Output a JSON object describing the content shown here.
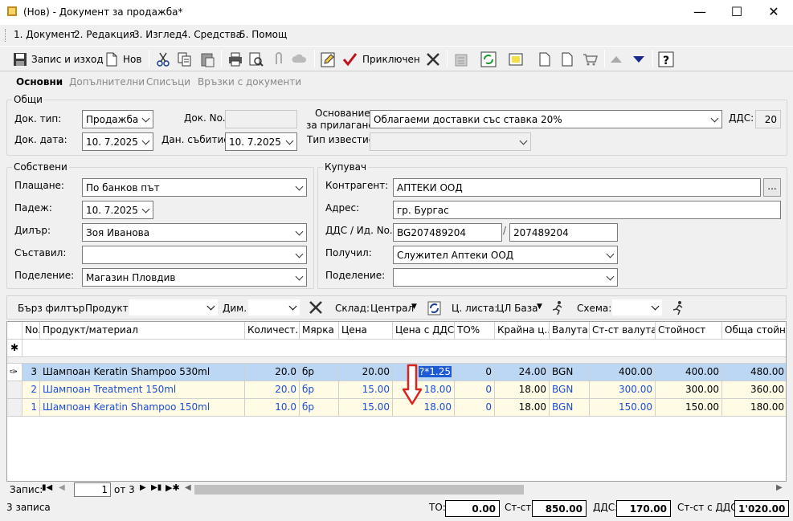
{
  "window": {
    "title": "(Нов) - Документ за продажба*"
  },
  "menu": [
    "1. Документ",
    "2. Редакция",
    "3. Изглед",
    "4. Средства",
    "5. Помощ"
  ],
  "toolbar": {
    "save_exit": "Запис и изход",
    "new": "Нов",
    "finished": "Приключен"
  },
  "tabs": [
    "Основни",
    "Допълнителни",
    "Списъци",
    "Връзки с документи"
  ],
  "general": {
    "group": "Общи",
    "doc_type_label": "Док. тип:",
    "doc_type": "Продажба",
    "doc_no_label": "Док. No.",
    "doc_no": "",
    "basis_label1": "Основание",
    "basis_label2": "за прилагане:",
    "basis": "Облагаеми доставки със ставка 20%",
    "vat_label": "ДДС:",
    "vat": "20",
    "doc_date_label": "Док. дата:",
    "doc_date": "10.  7.2025",
    "tax_date_label": "Дан. събитие:",
    "tax_date": "10.  7.2025",
    "notice_label": "Тип известие:",
    "notice": ""
  },
  "own": {
    "group": "Собствени",
    "payment_label": "Плащане:",
    "payment": "По банков път",
    "due_label": "Падеж:",
    "due": "10.  7.2025",
    "dealer_label": "Дилър:",
    "dealer": "Зоя Иванова",
    "composer_label": "Съставил:",
    "composer": "",
    "dept_label": "Поделение:",
    "dept": "Магазин Пловдив"
  },
  "buyer": {
    "group": "Купувач",
    "partner_label": "Контрагент:",
    "partner": "АПТЕКИ ООД",
    "address_label": "Адрес:",
    "address": "гр. Бургас",
    "vat_id_label": "ДДС / Ид. No.",
    "vat_no": "BG207489204",
    "id_no": "207489204",
    "receiver_label": "Получил:",
    "receiver": "Служител Аптеки ООД",
    "dept_label": "Поделение:",
    "dept": "",
    "browse": "..."
  },
  "filterbar": {
    "quick_filter": "Бърз филтър",
    "product_label": "Продукт:",
    "dim_label": "Дим.",
    "warehouse_label": "Склад:",
    "warehouse": "Централ",
    "pricelist_label": "Ц. листа:",
    "pricelist": "ЦЛ База",
    "scheme_label": "Схема:"
  },
  "grid": {
    "columns": [
      "No.",
      "Продукт/материал",
      "Количест...",
      "Мярка",
      "Цена",
      "Цена с ДДС",
      "ТО%",
      "Крайна ц...",
      "Валута",
      "Ст-ст валута",
      "Стойност",
      "Обща стойн..."
    ],
    "rows": [
      {
        "no": "3",
        "product": "Шампоан Keratin Shampoo 530ml",
        "qty": "20.0",
        "unit": "бр",
        "price": "20.00",
        "price_vat": "?*1.25",
        "to": "0",
        "final": "24.00",
        "cur": "BGN",
        "cost_cur": "400.00",
        "value": "400.00",
        "total": "480.00"
      },
      {
        "no": "2",
        "product": "Шампоан Treatment 150ml",
        "qty": "20.0",
        "unit": "бр",
        "price": "15.00",
        "price_vat": "18.00",
        "to": "0",
        "final": "18.00",
        "cur": "BGN",
        "cost_cur": "300.00",
        "value": "300.00",
        "total": "360.00"
      },
      {
        "no": "1",
        "product": "Шампоан Keratin Shampoo 150ml",
        "qty": "10.0",
        "unit": "бр",
        "price": "15.00",
        "price_vat": "18.00",
        "to": "0",
        "final": "18.00",
        "cur": "BGN",
        "cost_cur": "150.00",
        "value": "150.00",
        "total": "180.00"
      }
    ]
  },
  "nav": {
    "label": "Запис:",
    "current": "1",
    "of": "от 3"
  },
  "status": {
    "records": "3 записа",
    "to_label": "ТО:",
    "to": "0.00",
    "cost_label": "Ст-ст:",
    "cost": "850.00",
    "vat_label": "ДДС:",
    "vat": "170.00",
    "cost_vat_label": "Ст-ст с ДДС:",
    "cost_vat": "1'020.00"
  },
  "colors": {
    "selected_row": "#bcd7f3",
    "yellow_row": "#fffbe5",
    "arrow": "#d9231c",
    "blue_text": "#1a4ed8"
  }
}
